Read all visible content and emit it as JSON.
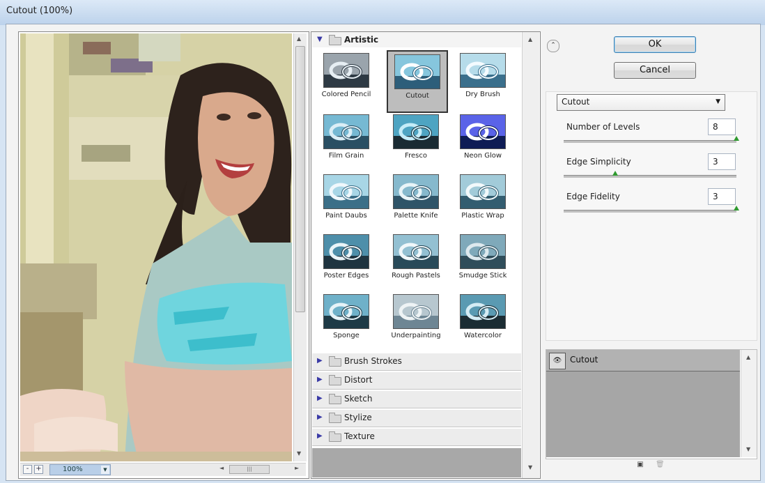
{
  "window": {
    "title": "Cutout (100%)"
  },
  "preview": {
    "zoom_minus": "-",
    "zoom_plus": "+",
    "zoom_value": "100%",
    "zoom_dropdown_icon": "chevron-down-icon",
    "hscroll_grip": "|||"
  },
  "gallery": {
    "open_category": "Artistic",
    "filters": [
      {
        "label": "Colored Pencil",
        "selected": false
      },
      {
        "label": "Cutout",
        "selected": true
      },
      {
        "label": "Dry Brush",
        "selected": false
      },
      {
        "label": "Film Grain",
        "selected": false
      },
      {
        "label": "Fresco",
        "selected": false
      },
      {
        "label": "Neon Glow",
        "selected": false
      },
      {
        "label": "Paint Daubs",
        "selected": false
      },
      {
        "label": "Palette Knife",
        "selected": false
      },
      {
        "label": "Plastic Wrap",
        "selected": false
      },
      {
        "label": "Poster Edges",
        "selected": false
      },
      {
        "label": "Rough Pastels",
        "selected": false
      },
      {
        "label": "Smudge Stick",
        "selected": false
      },
      {
        "label": "Sponge",
        "selected": false
      },
      {
        "label": "Underpainting",
        "selected": false
      },
      {
        "label": "Watercolor",
        "selected": false
      }
    ],
    "collapsed_categories": [
      "Brush Strokes",
      "Distort",
      "Sketch",
      "Stylize",
      "Texture"
    ]
  },
  "buttons": {
    "ok": "OK",
    "cancel": "Cancel"
  },
  "settings": {
    "filter_select": "Cutout",
    "params": [
      {
        "label": "Number of Levels",
        "value": "8",
        "level_fraction": 1.0
      },
      {
        "label": "Edge Simplicity",
        "value": "3",
        "level_fraction": 0.3
      },
      {
        "label": "Edge Fidelity",
        "value": "3",
        "level_fraction": 1.0
      }
    ]
  },
  "layers": {
    "items": [
      {
        "label": "Cutout"
      }
    ]
  },
  "colors": {
    "slider_thumb": "#2f9a2f",
    "accent": "#3c7fb1",
    "category_arrow": "#3a3aa6"
  }
}
